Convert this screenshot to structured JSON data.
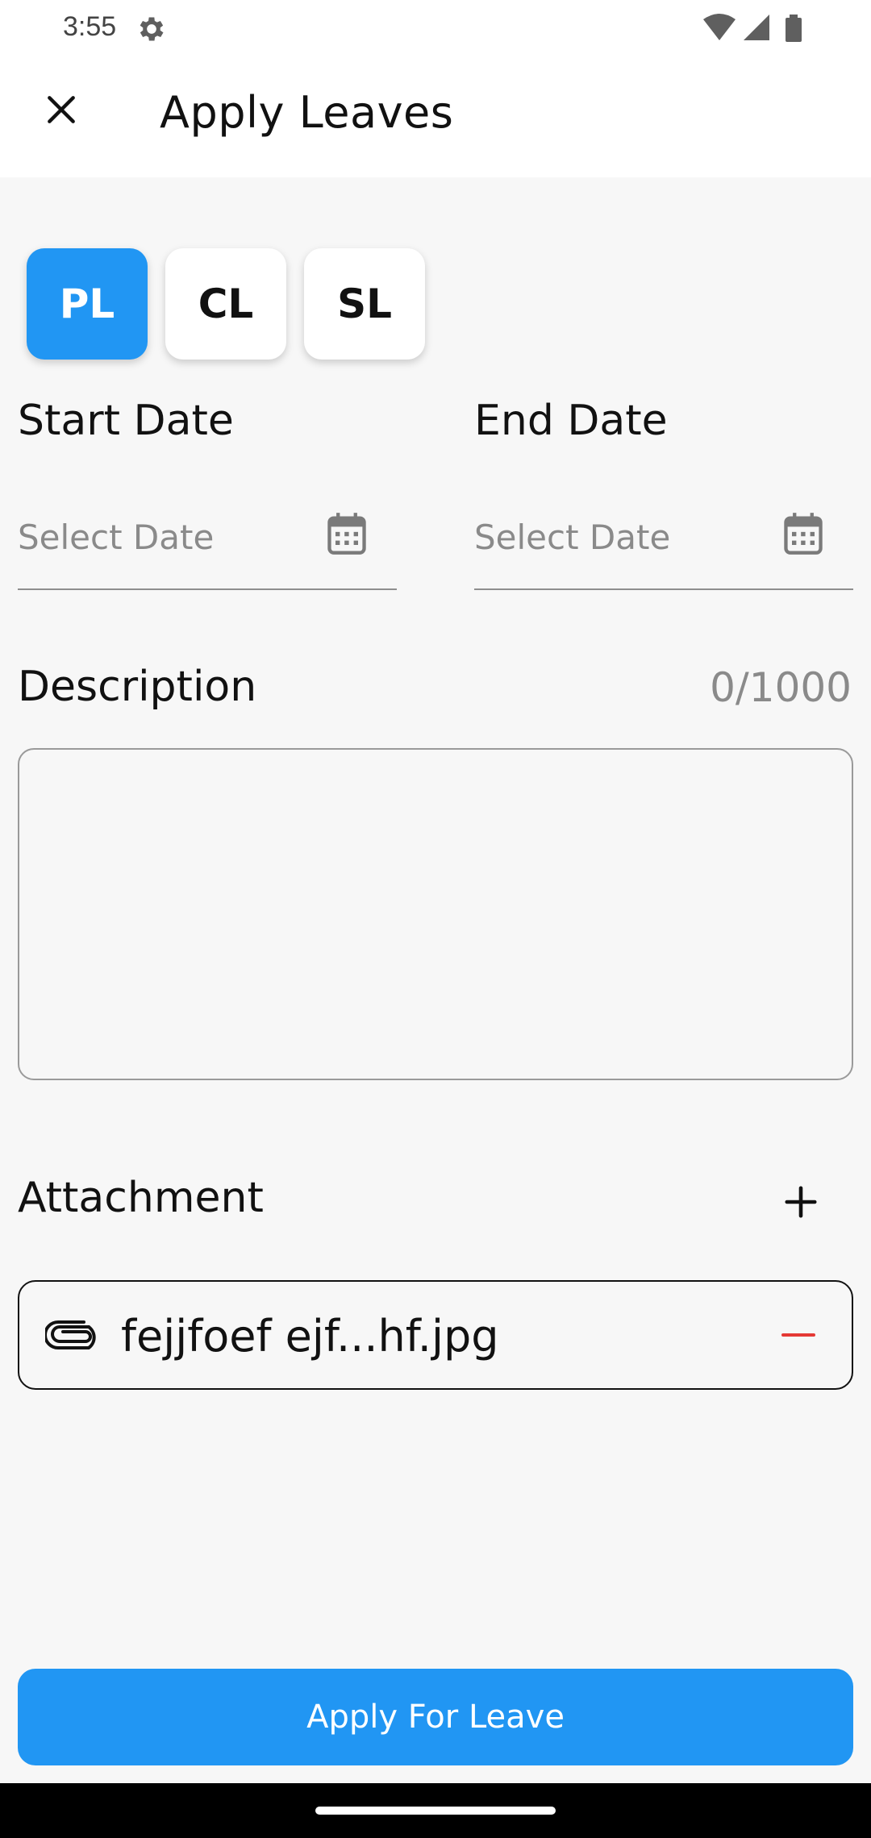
{
  "status_bar": {
    "time": "3:55"
  },
  "header": {
    "title": "Apply Leaves",
    "close_icon": "close-icon"
  },
  "leave_types": [
    {
      "label": "PL",
      "selected": true
    },
    {
      "label": "CL",
      "selected": false
    },
    {
      "label": "SL",
      "selected": false
    }
  ],
  "dates": {
    "start_label": "Start Date",
    "end_label": "End Date",
    "start_placeholder": "Select Date",
    "end_placeholder": "Select Date",
    "start_value": "",
    "end_value": ""
  },
  "description": {
    "label": "Description",
    "counter": "0/1000",
    "value": ""
  },
  "attachment": {
    "label": "Attachment",
    "file_name": "fejjfoef ejf...hf.jpg"
  },
  "actions": {
    "apply_label": "Apply For Leave"
  },
  "colors": {
    "accent": "#2196f3",
    "remove": "#e53935",
    "background": "#f7f7f7"
  }
}
